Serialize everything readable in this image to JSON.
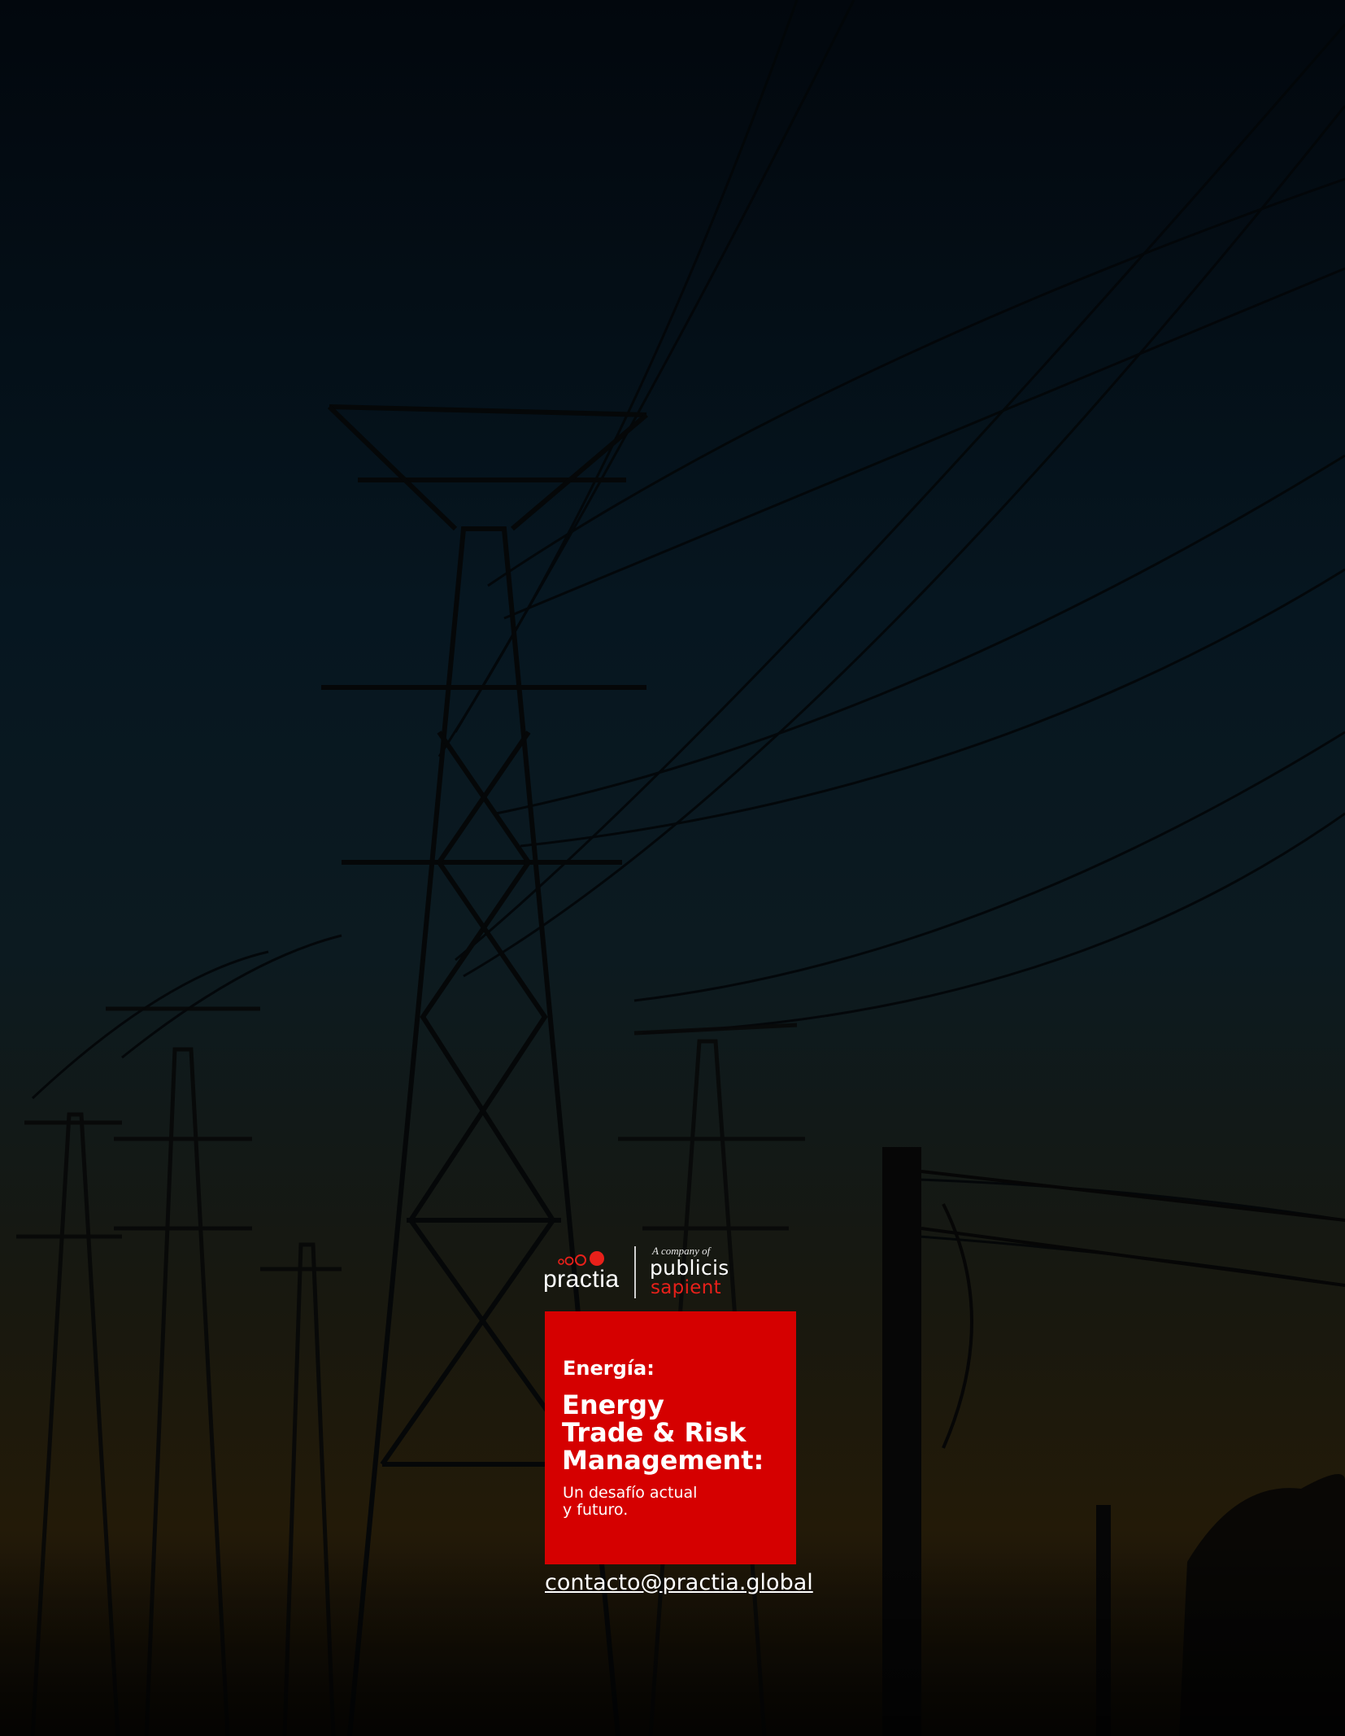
{
  "colors": {
    "accent": "#d50000",
    "brand_red": "#e8201a",
    "sky_top": "#02070d",
    "sky_bottom": "#231a08"
  },
  "background": {
    "icon": "power-transmission-towers-photo"
  },
  "logo": {
    "practia": "practia",
    "company_of": "A company of",
    "publicis": "publicis",
    "sapient": "sapient"
  },
  "card": {
    "kicker": "Energía:",
    "title_lines": [
      "Energy",
      "Trade & Risk",
      "Management:"
    ],
    "subtitle_lines": [
      "Un desafío actual",
      "y futuro."
    ]
  },
  "contact": {
    "email": "contacto@practia.global"
  }
}
